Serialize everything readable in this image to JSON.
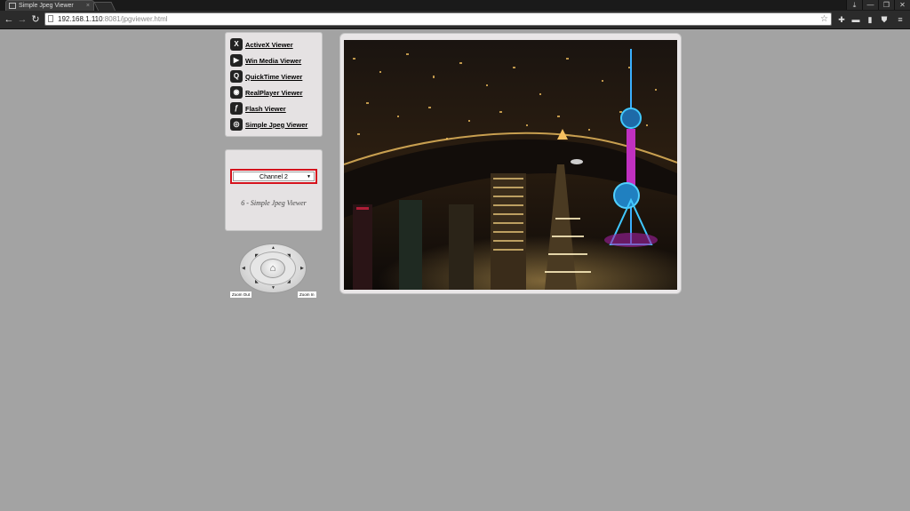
{
  "browser": {
    "tab_title": "Simple Jpeg Viewer",
    "tab_close": "×",
    "url_host": "192.168.1.110",
    "url_port_path": ":8081/jpgviewer.html",
    "window_controls": [
      "⤓",
      "—",
      "❐",
      "✕"
    ]
  },
  "menu": {
    "items": [
      {
        "label": "ActiveX Viewer",
        "icon": "activex-icon",
        "glyph": "X"
      },
      {
        "label": "Win Media Viewer",
        "icon": "media-player-icon",
        "glyph": "▶"
      },
      {
        "label": "QuickTime Viewer",
        "icon": "quicktime-icon",
        "glyph": "Q"
      },
      {
        "label": "RealPlayer Viewer",
        "icon": "realplayer-icon",
        "glyph": "◉"
      },
      {
        "label": "Flash Viewer",
        "icon": "flash-icon",
        "glyph": "ƒ"
      },
      {
        "label": "Simple Jpeg Viewer",
        "icon": "jpeg-icon",
        "glyph": "◎"
      }
    ]
  },
  "channel": {
    "selected": "Channel 2",
    "caption": "6 - Simple Jpeg Viewer"
  },
  "ptz": {
    "zoom_out": "Zoom Out",
    "zoom_in": "Zoom In"
  },
  "colors": {
    "page_bg": "#a3a3a3",
    "panel_bg": "#e5e2e3",
    "select_border": "#d4121c"
  }
}
